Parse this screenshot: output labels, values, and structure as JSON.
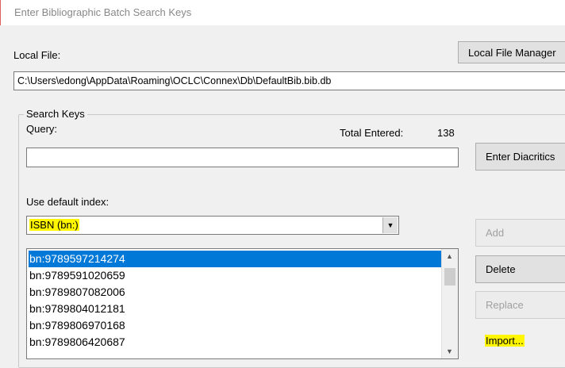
{
  "window": {
    "title": "Enter Bibliographic Batch Search Keys"
  },
  "local_file": {
    "label": "Local File:",
    "manager_button": "Local File Manager",
    "path": "C:\\Users\\edong\\AppData\\Roaming\\OCLC\\Connex\\Db\\DefaultBib.bib.db"
  },
  "search_keys": {
    "group_label": "Search Keys",
    "query_label": "Query:",
    "query_value": "",
    "total_label": "Total Entered:",
    "total_value": "138",
    "diacritics_button": "Enter Diacritics",
    "index_label": "Use default index:",
    "index_selected": "ISBN (bn:)",
    "items": [
      "bn:9789597214274",
      "bn:9789591020659",
      "bn:9789807082006",
      "bn:9789804012181",
      "bn:9789806970168",
      "bn:9789806420687"
    ],
    "selected_index": 0
  },
  "buttons": {
    "add": "Add",
    "delete": "Delete",
    "replace": "Replace",
    "import": "Import..."
  },
  "colors": {
    "selection": "#0078d7",
    "highlight": "#fff600"
  }
}
